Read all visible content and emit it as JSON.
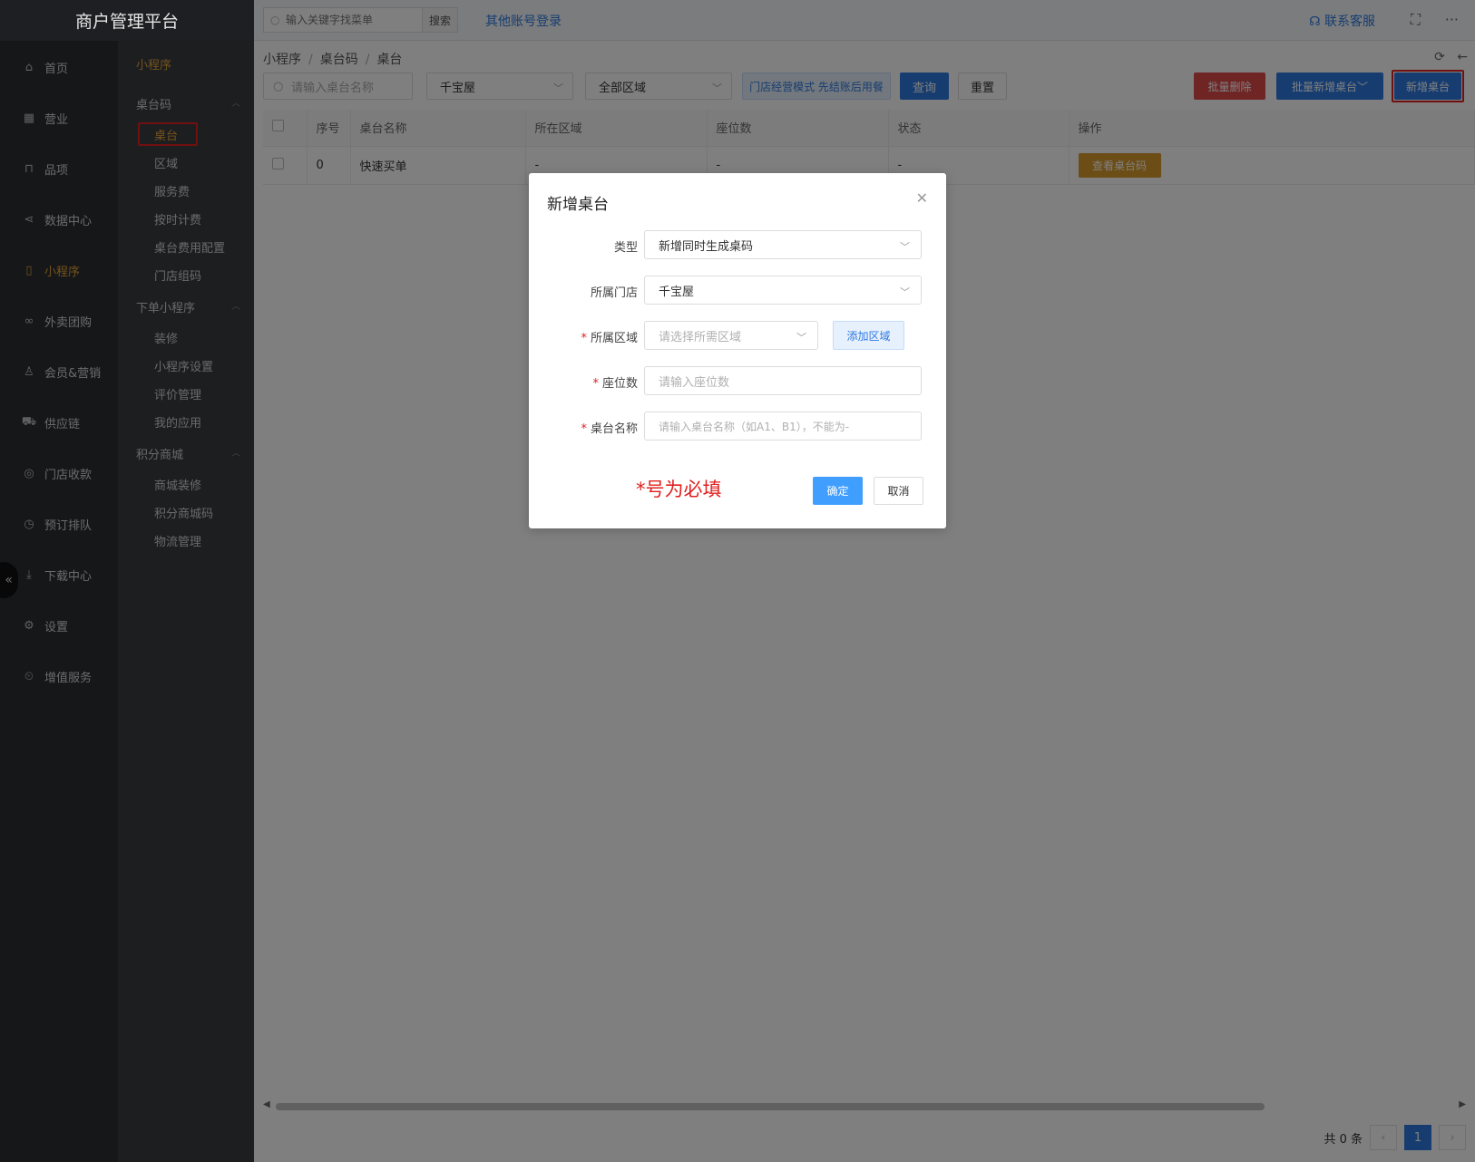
{
  "brand": "商户管理平台",
  "nav1": [
    {
      "label": "首页",
      "icon": "home-icon"
    },
    {
      "label": "营业",
      "icon": "calendar-icon"
    },
    {
      "label": "品项",
      "icon": "bag-icon"
    },
    {
      "label": "数据中心",
      "icon": "share-icon"
    },
    {
      "label": "小程序",
      "icon": "tablet-icon"
    },
    {
      "label": "外卖团购",
      "icon": "bike-icon"
    },
    {
      "label": "会员&营销",
      "icon": "user-icon"
    },
    {
      "label": "供应链",
      "icon": "truck-icon"
    },
    {
      "label": "门店收款",
      "icon": "coins-icon"
    },
    {
      "label": "预订排队",
      "icon": "clock-icon"
    },
    {
      "label": "下载中心",
      "icon": "download-icon"
    },
    {
      "label": "设置",
      "icon": "gear-icon"
    },
    {
      "label": "增值服务",
      "icon": "alarm-icon"
    }
  ],
  "nav2": {
    "head": "小程序",
    "groups": [
      {
        "label": "桌台码",
        "items": [
          "桌台",
          "区域",
          "服务费",
          "按时计费",
          "桌台费用配置",
          "门店组码"
        ]
      },
      {
        "label": "下单小程序",
        "items": [
          "装修",
          "小程序设置",
          "评价管理",
          "我的应用"
        ]
      },
      {
        "label": "积分商城",
        "items": [
          "商城装修",
          "积分商城码",
          "物流管理"
        ]
      }
    ]
  },
  "topbar": {
    "search_placeholder": "输入关键字找菜单",
    "search_btn": "搜索",
    "other_login": "其他账号登录",
    "service": "联系客服"
  },
  "breadcrumb": [
    "小程序",
    "桌台码",
    "桌台"
  ],
  "filters": {
    "name_placeholder": "请输入桌台名称",
    "store": "千宝屋",
    "area": "全部区域",
    "mode": "门店经营模式 先结账后用餐",
    "query": "查询",
    "reset": "重置",
    "batch_delete": "批量删除",
    "batch_add": "批量新增桌台",
    "add": "新增桌台"
  },
  "table": {
    "columns": [
      "序号",
      "桌台名称",
      "所在区域",
      "座位数",
      "状态",
      "操作"
    ],
    "rows": [
      {
        "no": "0",
        "name": "快速买单",
        "area": "-",
        "seats": "-",
        "status": "-",
        "action": "查看桌台码"
      }
    ]
  },
  "pager": {
    "total": "共 0 条",
    "current": "1"
  },
  "modal": {
    "title": "新增桌台",
    "type_label": "类型",
    "type_value": "新增同时生成桌码",
    "store_label": "所属门店",
    "store_value": "千宝屋",
    "area_label": "所属区域",
    "area_placeholder": "请选择所需区域",
    "add_area": "添加区域",
    "seats_label": "座位数",
    "seats_placeholder": "请输入座位数",
    "name_label": "桌台名称",
    "name_placeholder": "请输入桌台名称（如A1、B1），不能为-",
    "required_note": "*号为必填",
    "ok": "确定",
    "cancel": "取消"
  }
}
